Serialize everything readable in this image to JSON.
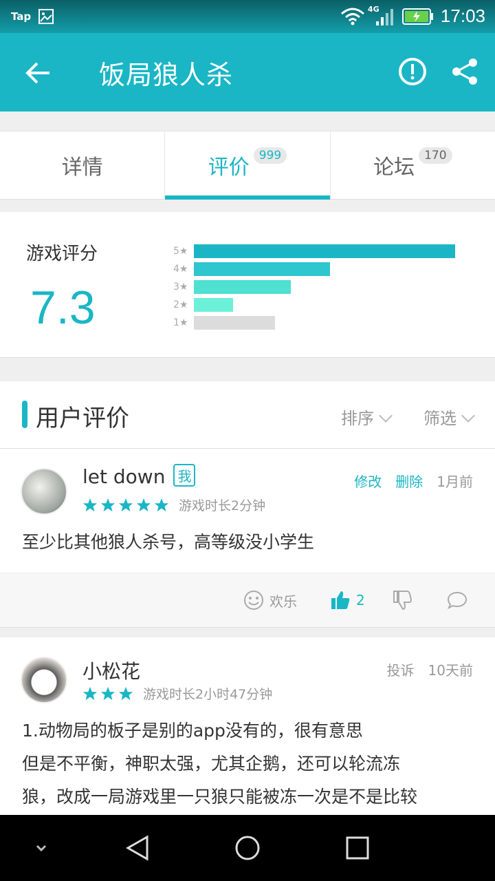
{
  "status_bar": {
    "app_label": "Tap",
    "network": "4G",
    "time": "17:03"
  },
  "app_bar": {
    "title": "饭局狼人杀"
  },
  "tabs": [
    {
      "label": "详情",
      "badge": ""
    },
    {
      "label": "评价",
      "badge": "999",
      "active": true
    },
    {
      "label": "论坛",
      "badge": "170"
    }
  ],
  "rating": {
    "label": "游戏评分",
    "score": "7.3",
    "distribution": [
      {
        "level": "5",
        "share": 1.0,
        "color": "#1ab6c5"
      },
      {
        "level": "4",
        "share": 0.52,
        "color": "#2ec6cf"
      },
      {
        "level": "3",
        "share": 0.37,
        "color": "#4fe0d2"
      },
      {
        "level": "2",
        "share": 0.15,
        "color": "#6cf0d8"
      },
      {
        "level": "1",
        "share": 0.31,
        "color": "#dcdcdc"
      }
    ]
  },
  "reviews_header": {
    "title": "用户评价",
    "sort_label": "排序",
    "filter_label": "筛选"
  },
  "reviews": [
    {
      "user": "let down",
      "me_badge": "我",
      "stars": 5,
      "playtime": "游戏时长2分钟",
      "edit_label": "修改",
      "delete_label": "删除",
      "date": "1月前",
      "content": "至少比其他狼人杀号，高等级没小学生",
      "mood": "欢乐",
      "likes": "2"
    },
    {
      "user": "小松花",
      "stars": 3,
      "playtime": "游戏时长2小时47分钟",
      "report_label": "投诉",
      "date": "10天前",
      "content_lines": [
        "1.动物局的板子是别的app没有的，很有意思",
        "但是不平衡，神职太强，尤其企鹅，还可以轮流冻",
        "狼，改成一局游戏里一只狼只能被冻一次是不是比较"
      ]
    }
  ]
}
